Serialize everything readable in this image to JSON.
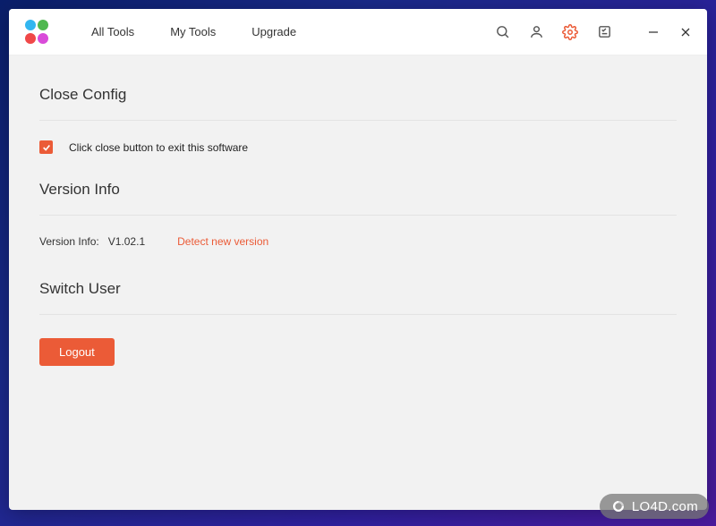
{
  "nav": {
    "all_tools": "All Tools",
    "my_tools": "My Tools",
    "upgrade": "Upgrade"
  },
  "sections": {
    "close_config": {
      "title": "Close Config",
      "checkbox_label": "Click close button to exit this software"
    },
    "version_info": {
      "title": "Version Info",
      "label": "Version Info:",
      "value": "V1.02.1",
      "detect_label": "Detect new version"
    },
    "switch_user": {
      "title": "Switch User",
      "logout_label": "Logout"
    }
  },
  "watermark": "LO4D.com"
}
